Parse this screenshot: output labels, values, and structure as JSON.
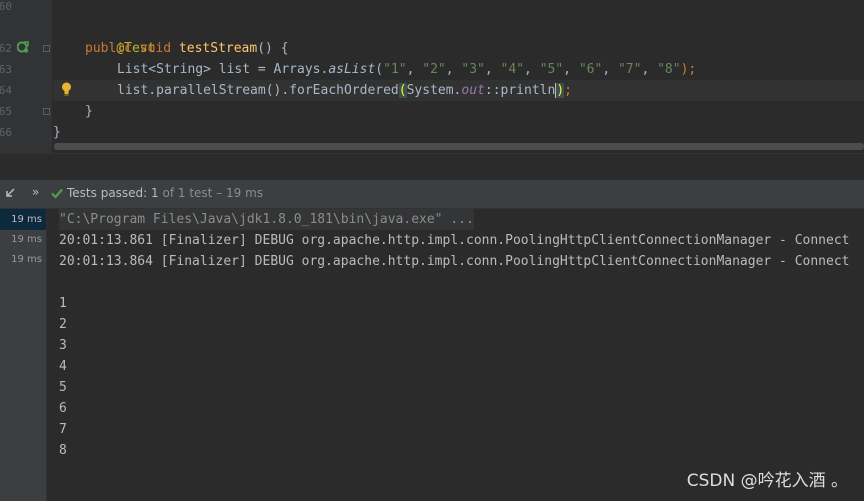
{
  "editor": {
    "line_numbers": [
      "60",
      "62",
      "63",
      "64",
      "65",
      "66"
    ],
    "code": {
      "annotation": "@Test",
      "method_signature": {
        "kw1": "public",
        "kw2": "void",
        "name": "testStream",
        "rest": "() {"
      },
      "list_line": {
        "type": "List<String> list = Arrays.",
        "method": "asList",
        "open": "(",
        "args": [
          "\"1\"",
          "\"2\"",
          "\"3\"",
          "\"4\"",
          "\"5\"",
          "\"6\"",
          "\"7\"",
          "\"8\""
        ],
        "close": ");"
      },
      "stream_line": {
        "prefix": "list.parallelStream().forEachOrdered",
        "open": "(",
        "cls": "System.",
        "field": "out",
        "sep": "::",
        "method": "println",
        "close": ")",
        "end": ";"
      },
      "close_method": "}",
      "close_class": "}"
    }
  },
  "run_panel": {
    "status": "Tests passed:",
    "passed_count": "1",
    "summary": "of 1 test – 19 ms",
    "durations": [
      "19 ms",
      "19 ms",
      "19 ms"
    ]
  },
  "console": {
    "lines": [
      "\"C:\\Program Files\\Java\\jdk1.8.0_181\\bin\\java.exe\" ...",
      "20:01:13.861 [Finalizer] DEBUG org.apache.http.impl.conn.PoolingHttpClientConnectionManager - Connect",
      "20:01:13.864 [Finalizer] DEBUG org.apache.http.impl.conn.PoolingHttpClientConnectionManager - Connect",
      "",
      "1",
      "2",
      "3",
      "4",
      "5",
      "6",
      "7",
      "8"
    ]
  },
  "watermark": "CSDN @吟花入酒 。",
  "colors": {
    "pass": "#4f9e4f",
    "bulb": "#e8b534",
    "keyword": "#cc7832",
    "string": "#6a8759"
  }
}
